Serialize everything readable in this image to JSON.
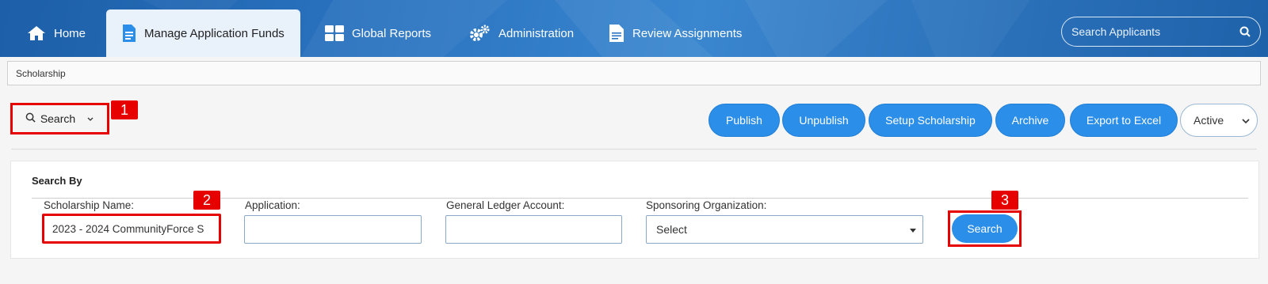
{
  "nav": {
    "items": [
      {
        "label": "Home",
        "icon": "home-icon"
      },
      {
        "label": "Manage Application Funds",
        "icon": "document-icon",
        "active": true
      },
      {
        "label": "Global Reports",
        "icon": "grid-icon"
      },
      {
        "label": "Administration",
        "icon": "gears-icon"
      },
      {
        "label": "Review Assignments",
        "icon": "document-icon"
      }
    ],
    "search_placeholder": "Search Applicants"
  },
  "breadcrumb": "Scholarship",
  "toolbar": {
    "search_toggle_label": "Search",
    "actions": [
      "Publish",
      "Unpublish",
      "Setup Scholarship",
      "Archive",
      "Export to Excel"
    ],
    "status_value": "Active"
  },
  "search_panel": {
    "title": "Search By",
    "fields": {
      "scholarship_name": {
        "label": "Scholarship Name:",
        "value": "2023 - 2024 CommunityForce S"
      },
      "application": {
        "label": "Application:",
        "value": ""
      },
      "general_ledger": {
        "label": "General Ledger Account:",
        "value": ""
      },
      "sponsoring_org": {
        "label": "Sponsoring Organization:",
        "value": "Select"
      }
    },
    "search_button": "Search"
  },
  "annotations": [
    "1",
    "2",
    "3"
  ],
  "colors": {
    "accent": "#2b8ee8",
    "nav": "#2a73c0",
    "highlight": "#e60000"
  }
}
